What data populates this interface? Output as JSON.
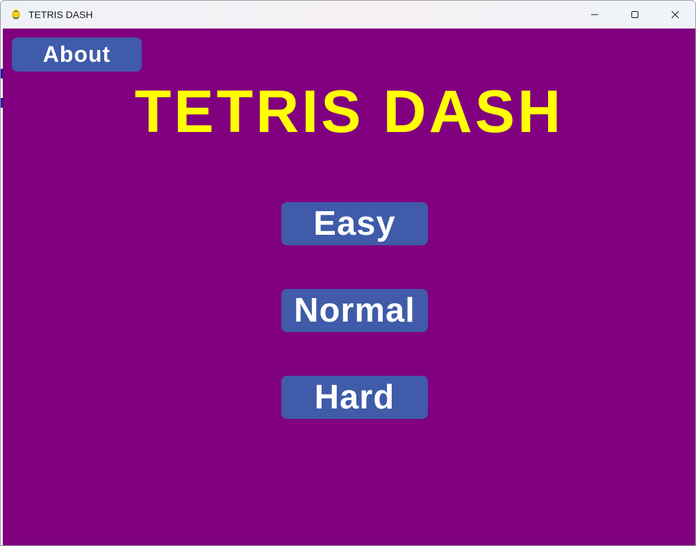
{
  "window": {
    "title": "TETRIS DASH",
    "icon": "pygame-snake-icon",
    "controls": [
      "minimize-icon",
      "maximize-icon",
      "close-icon"
    ]
  },
  "game": {
    "title": "TETRIS DASH",
    "about_label": "About",
    "modes": [
      "Easy",
      "Normal",
      "Hard"
    ]
  },
  "colors": {
    "background": "#800080",
    "button": "#3f5ba9",
    "title": "#ffff00",
    "button_text": "#ffffff"
  }
}
